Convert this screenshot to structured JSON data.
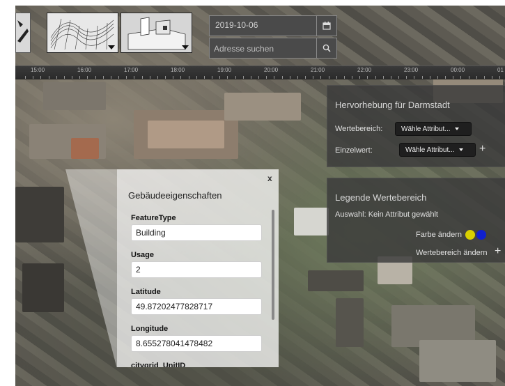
{
  "toolbar": {
    "date_value": "2019-10-06",
    "address_placeholder": "Adresse suchen",
    "calendar_icon": "calendar-icon",
    "search_icon": "search-icon"
  },
  "timeline": {
    "labels": [
      "15:00",
      "16:00",
      "17:00",
      "18:00",
      "19:00",
      "20:00",
      "21:00",
      "22:00",
      "23:00",
      "00:00",
      "01"
    ]
  },
  "highlight_panel": {
    "title": "Hervorhebung für Darmstadt",
    "range_label": "Wertebereich:",
    "range_dropdown": "Wähle Attribut...",
    "single_label": "Einzelwert:",
    "single_dropdown": "Wähle Attribut...",
    "add_symbol": "+"
  },
  "legend_panel": {
    "title": "Legende Wertebereich",
    "selection_text": "Auswahl: Kein Attribut gewählt",
    "change_color": "Farbe ändern",
    "change_range": "Wertebereich ändern",
    "add_symbol": "+",
    "color_low": "#d9d000",
    "color_high": "#1020d0"
  },
  "popup": {
    "title": "Gebäudeeigenschaften",
    "close_symbol": "x",
    "properties": [
      {
        "label": "FeatureType",
        "value": "Building"
      },
      {
        "label": "Usage",
        "value": "2"
      },
      {
        "label": "Latitude",
        "value": "49.87202477828717"
      },
      {
        "label": "Longitude",
        "value": "8.655278041478482"
      },
      {
        "label": "citygrid_UnitID",
        "value": ""
      }
    ]
  }
}
